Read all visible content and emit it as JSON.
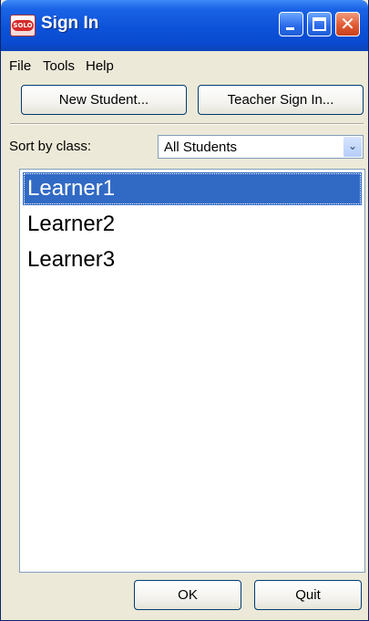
{
  "window": {
    "title": "Sign In",
    "app_icon_text": "SOLO",
    "controls": {
      "minimize": "minimize-icon",
      "maximize": "maximize-icon",
      "close": "close-icon"
    }
  },
  "menu": {
    "items": [
      "File",
      "Tools",
      "Help"
    ]
  },
  "toolbar": {
    "new_student_label": "New Student...",
    "teacher_sign_in_label": "Teacher Sign In..."
  },
  "filter": {
    "label": "Sort by class:",
    "selected": "All Students"
  },
  "students": {
    "items": [
      "Learner1",
      "Learner2",
      "Learner3"
    ],
    "selected_index": 0
  },
  "footer": {
    "ok_label": "OK",
    "quit_label": "Quit"
  },
  "colors": {
    "title_bar": "#0b52d8",
    "window_bg": "#ece9d8",
    "selection": "#316ac5",
    "close_button": "#e05a33"
  }
}
